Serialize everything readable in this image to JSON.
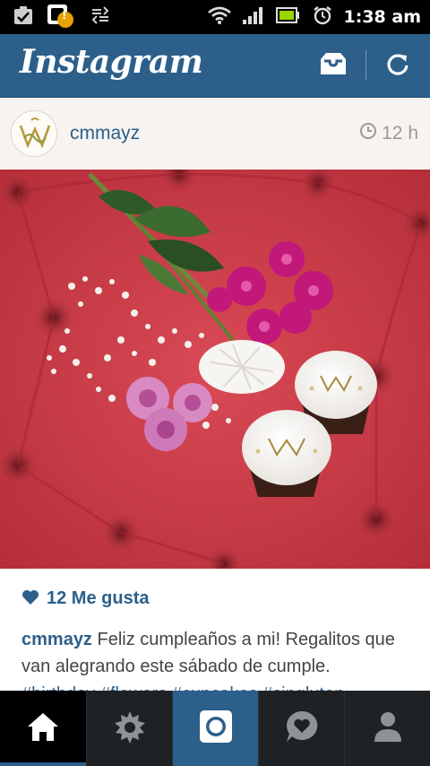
{
  "status_bar": {
    "time": "1:38 am",
    "notification_badge": "!",
    "icons": [
      "checklist-icon",
      "notification-icon",
      "data-transfer-icon",
      "wifi-icon",
      "signal-icon",
      "battery-icon",
      "alarm-icon"
    ]
  },
  "app_bar": {
    "title": "Instagram",
    "inbox_icon": "inbox-icon",
    "refresh_icon": "refresh-icon",
    "color": "#2c5f8a"
  },
  "post": {
    "username": "cmmayz",
    "time": "12 h",
    "likes": "12 Me gusta",
    "caption_user": "cmmayz",
    "caption_text": " Feliz cumpleaños a mi! Regalitos que van alegrando este sábado de cumple.",
    "hashtags": "#birthday #flowers #cupcakes #singluten"
  },
  "nav": {
    "items": [
      "home-icon",
      "explore-icon",
      "camera-icon",
      "activity-icon",
      "profile-icon"
    ]
  }
}
